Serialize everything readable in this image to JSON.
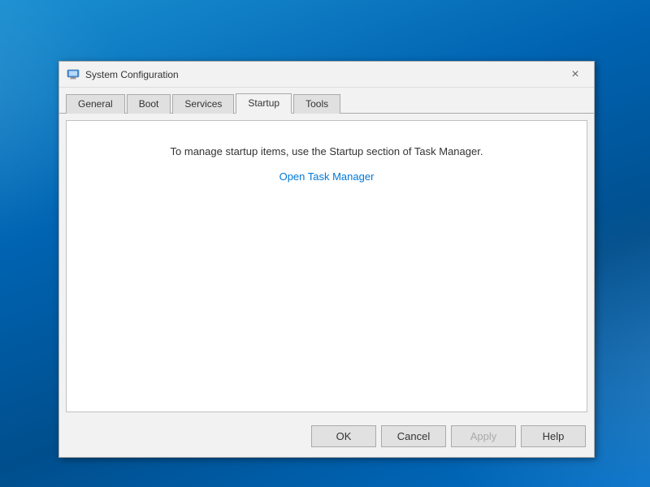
{
  "desktop": {
    "background": "Windows 10 desktop"
  },
  "dialog": {
    "title": "System Configuration",
    "icon": "system-config-icon",
    "close_label": "×"
  },
  "tabs": [
    {
      "id": "general",
      "label": "General",
      "active": false
    },
    {
      "id": "boot",
      "label": "Boot",
      "active": false
    },
    {
      "id": "services",
      "label": "Services",
      "active": false
    },
    {
      "id": "startup",
      "label": "Startup",
      "active": true
    },
    {
      "id": "tools",
      "label": "Tools",
      "active": false
    }
  ],
  "content": {
    "message": "To manage startup items, use the Startup section of Task Manager.",
    "link_text": "Open Task Manager"
  },
  "buttons": {
    "ok": "OK",
    "cancel": "Cancel",
    "apply": "Apply",
    "help": "Help"
  }
}
